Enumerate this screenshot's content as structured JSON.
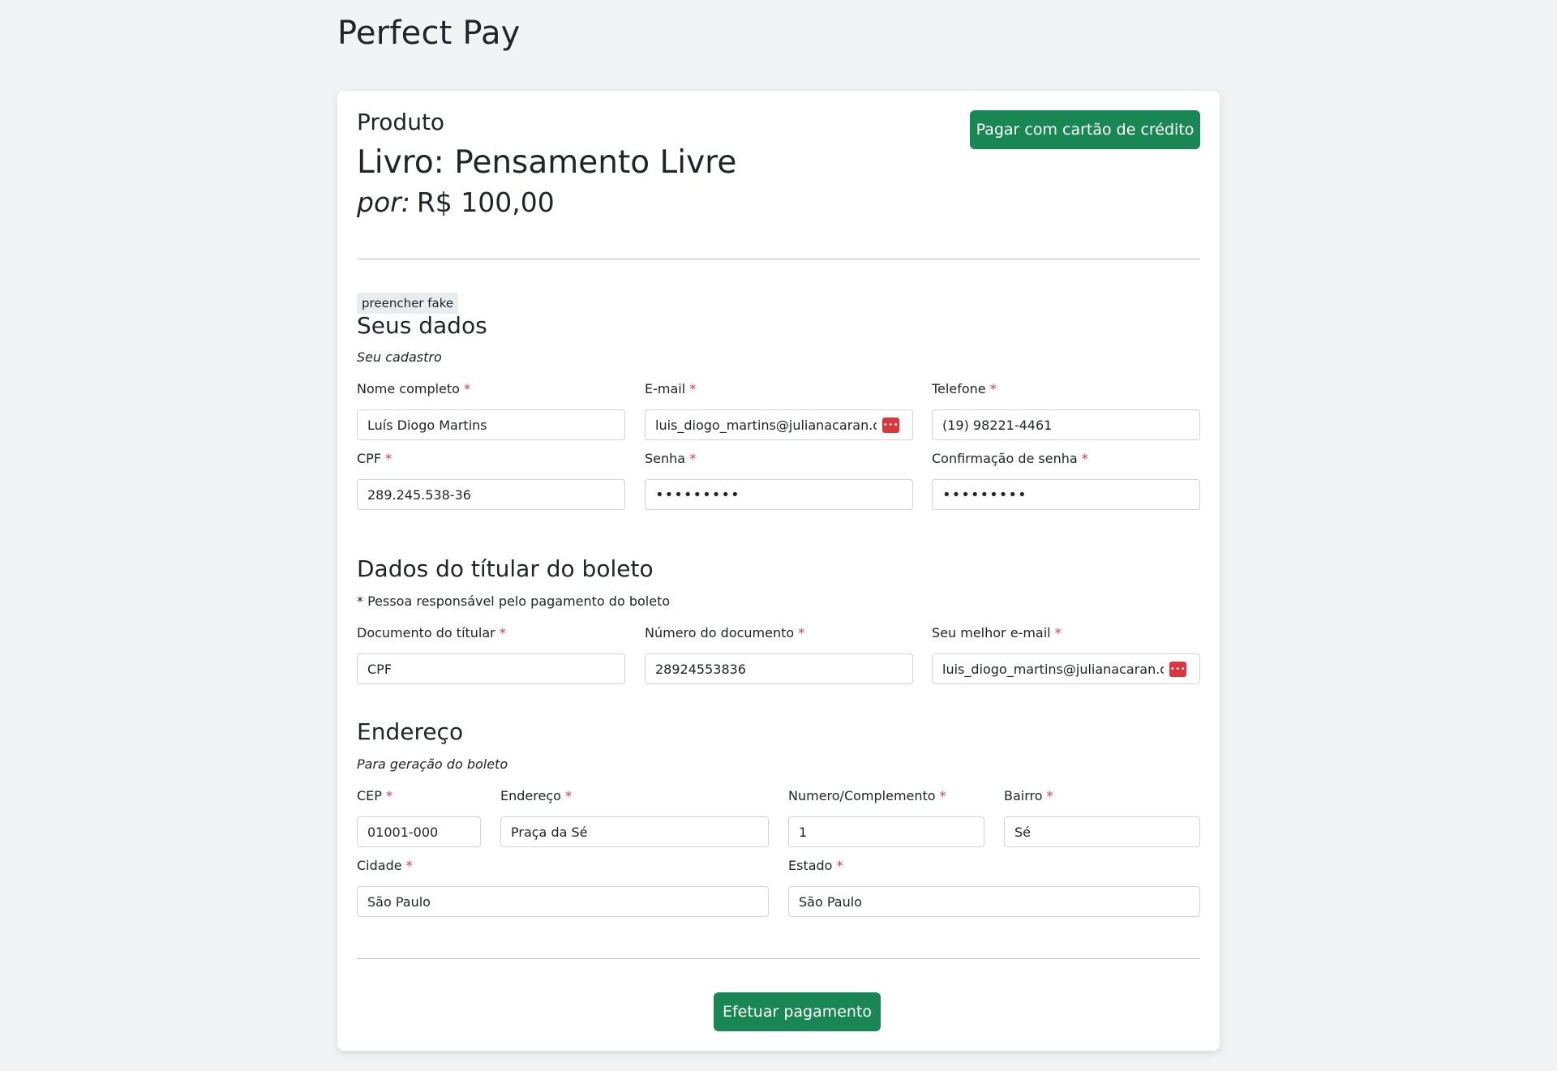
{
  "app": {
    "title": "Perfect Pay"
  },
  "product": {
    "label": "Produto",
    "name": "Livro: Pensamento Livre",
    "price_prefix": "por:",
    "price": "R$ 100,00",
    "credit_button": "Pagar com cartão de crédito"
  },
  "fake_button": "preencher fake",
  "seus_dados": {
    "title": "Seus dados",
    "subtitle": "Seu cadastro",
    "fields": {
      "nome": {
        "label": "Nome completo",
        "value": "Luís Diogo Martins"
      },
      "email": {
        "label": "E-mail",
        "value": "luis_diogo_martins@julianacaran.com.br"
      },
      "telefone": {
        "label": "Telefone",
        "value": "(19) 98221-4461"
      },
      "cpf": {
        "label": "CPF",
        "value": "289.245.538-36"
      },
      "senha": {
        "label": "Senha",
        "value": "•••••••••"
      },
      "confirmacao": {
        "label": "Confirmação de senha",
        "value": "•••••••••"
      }
    }
  },
  "titular": {
    "title": "Dados do títular do boleto",
    "subtitle": "* Pessoa responsável pelo pagamento do boleto",
    "fields": {
      "documento": {
        "label": "Documento do títular",
        "value": "CPF"
      },
      "numero_documento": {
        "label": "Número do documento",
        "value": "28924553836"
      },
      "melhor_email": {
        "label": "Seu melhor e-mail",
        "value": "luis_diogo_martins@julianacaran.com.br"
      }
    }
  },
  "endereco": {
    "title": "Endereço",
    "subtitle": "Para geração do boleto",
    "fields": {
      "cep": {
        "label": "CEP",
        "value": "01001-000"
      },
      "endereco": {
        "label": "Endereço",
        "value": "Praça da Sé"
      },
      "numero": {
        "label": "Numero/Complemento",
        "value": "1"
      },
      "bairro": {
        "label": "Bairro",
        "value": "Sé"
      },
      "cidade": {
        "label": "Cidade",
        "value": "São Paulo"
      },
      "estado": {
        "label": "Estado",
        "value": "São Paulo"
      }
    }
  },
  "required_marker": "*",
  "pay_button": "Efetuar pagamento",
  "password_manager_icon": "•••"
}
